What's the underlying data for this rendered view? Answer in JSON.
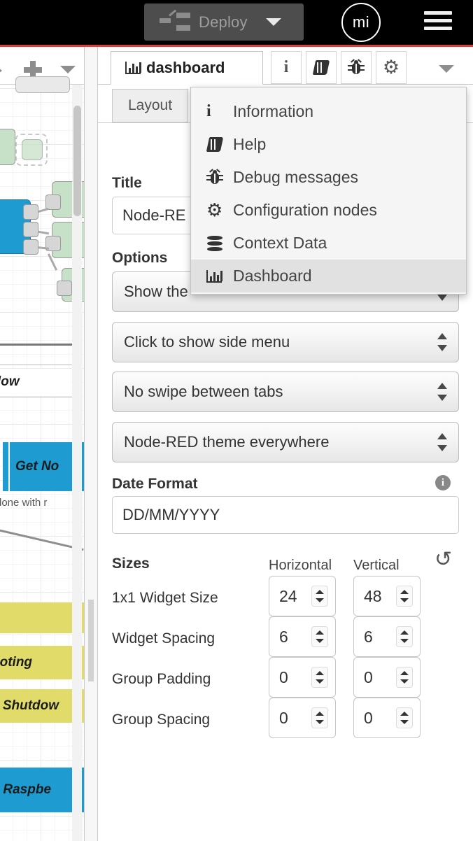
{
  "header": {
    "deploy_label": "Deploy",
    "deploy_icon": "deploy-nodes-icon",
    "deploy_caret_icon": "chevron-down-icon",
    "avatar_initials": "mi",
    "menu_icon": "hamburger-menu-icon"
  },
  "canvas": {
    "toolbar": {
      "back_icon": "arrow-right-icon",
      "add_icon": "plus-icon",
      "more_icon": "chevron-down-icon"
    },
    "labels": {
      "subflow": "bflow",
      "get_no": "Get No",
      "done_with": "done with r",
      "booting": "ooting",
      "shutdown": "s Shutdow",
      "raspberry": "> Raspbe"
    }
  },
  "sidebar": {
    "tab": {
      "icon": "bar-chart-icon",
      "label": "dashboard"
    },
    "icon_buttons": [
      {
        "name": "info-icon",
        "glyph": "i"
      },
      {
        "name": "help-book-icon",
        "glyph": "book"
      },
      {
        "name": "debug-bug-icon",
        "glyph": "bug"
      },
      {
        "name": "config-gear-icon",
        "glyph": "⚙"
      }
    ],
    "more_icon": "chevron-down-icon",
    "subtabs": [
      {
        "label": "Layout"
      }
    ],
    "title": {
      "label": "Title",
      "value": "Node-RE"
    },
    "options": {
      "label": "Options",
      "selects": [
        {
          "name": "show-title-bar-select",
          "value": "Show the"
        },
        {
          "name": "side-menu-select",
          "value": "Click to show side menu"
        },
        {
          "name": "swipe-select",
          "value": "No swipe between tabs"
        },
        {
          "name": "theme-select",
          "value": "Node-RED theme everywhere"
        }
      ]
    },
    "date_format": {
      "label": "Date Format",
      "value": "DD/MM/YYYY",
      "info_icon": "info-icon"
    },
    "sizes": {
      "label": "Sizes",
      "col_horizontal": "Horizontal",
      "col_vertical": "Vertical",
      "reset_icon": "reset-undo-icon",
      "rows": [
        {
          "label": "1x1 Widget Size",
          "horizontal": "24",
          "vertical": "48"
        },
        {
          "label": "Widget Spacing",
          "horizontal": "6",
          "vertical": "6"
        },
        {
          "label": "Group Padding",
          "horizontal": "0",
          "vertical": "0"
        },
        {
          "label": "Group Spacing",
          "horizontal": "0",
          "vertical": "0"
        }
      ]
    }
  },
  "dropdown_menu": {
    "items": [
      {
        "label": "Information",
        "icon": "info-icon",
        "active": false
      },
      {
        "label": "Help",
        "icon": "book-icon",
        "active": false
      },
      {
        "label": "Debug messages",
        "icon": "bug-icon",
        "active": false
      },
      {
        "label": "Configuration nodes",
        "icon": "gear-icon",
        "active": false
      },
      {
        "label": "Context Data",
        "icon": "database-icon",
        "active": false
      },
      {
        "label": "Dashboard",
        "icon": "bar-chart-icon",
        "active": true
      }
    ]
  },
  "colors": {
    "header_bg": "#000000",
    "accent_red": "#d93f3f",
    "node_blue": "#1e9bd1",
    "node_green": "#c7e0c8",
    "flow_yellow": "#e1dc6a",
    "menu_bg": "#f5f5f5",
    "menu_active_bg": "#e1e1e1"
  }
}
